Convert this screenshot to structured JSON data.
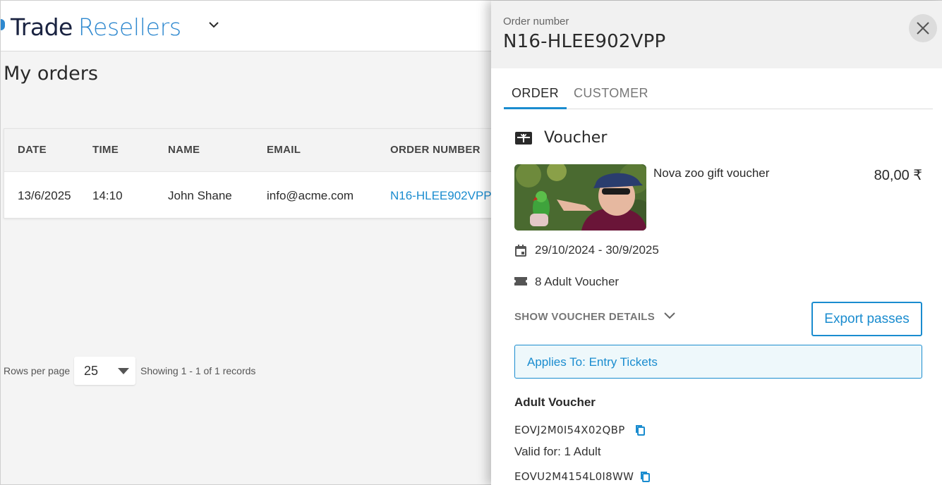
{
  "header": {
    "logo_trade": "Trade",
    "logo_resellers": "Resellers",
    "menu_icon": "chevron-down-icon"
  },
  "page": {
    "title": "My orders"
  },
  "orders_table": {
    "columns": [
      "DATE",
      "TIME",
      "NAME",
      "EMAIL",
      "ORDER NUMBER"
    ],
    "rows": [
      {
        "date": "13/6/2025",
        "time": "14:10",
        "name": "John Shane",
        "email": "info@acme.com",
        "order_number": "N16-HLEE902VPP"
      }
    ]
  },
  "pagination": {
    "rows_label": "Rows per page",
    "rows_value": "25",
    "showing": "Showing 1 - 1 of 1 records"
  },
  "panel": {
    "label": "Order number",
    "order_number": "N16-HLEE902VPP",
    "close_icon": "close-icon",
    "tabs": [
      {
        "label": "ORDER",
        "active": true
      },
      {
        "label": "CUSTOMER",
        "active": false
      }
    ],
    "section": {
      "icon": "voucher-icon",
      "title": "Voucher"
    },
    "product": {
      "name": "Nova zoo gift voucher",
      "price": "80,00 ₹"
    },
    "validity": {
      "icon": "calendar-icon",
      "text": "29/10/2024 - 30/9/2025"
    },
    "ticket": {
      "icon": "ticket-icon",
      "text": "8 Adult Voucher"
    },
    "show_details_label": "SHOW VOUCHER DETAILS",
    "export_label": "Export passes",
    "applies_to": "Applies To: Entry Tickets",
    "voucher_group": {
      "title": "Adult Voucher",
      "codes": [
        {
          "code": "EOVJ2M0I54X02QBP",
          "valid": "Valid for: 1 Adult"
        },
        {
          "code": "EOVU2M4154L0I8WW"
        }
      ]
    },
    "colors": {
      "accent": "#1a8ccf",
      "brand_dark": "#1a2341",
      "brand_blue": "#2e88cf"
    }
  }
}
